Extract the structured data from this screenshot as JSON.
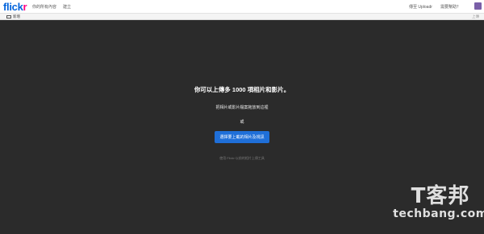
{
  "app": {
    "logo_main": "flick",
    "logo_accent": "r"
  },
  "topbar": {
    "nav_you": "你的所有內容",
    "nav_create": "建立",
    "upload": "傳至 Uploadr",
    "help": "需要幫助？",
    "avatar_icon": "user-avatar-icon"
  },
  "subbar": {
    "add_label": "新增",
    "right_label": "上傳"
  },
  "main": {
    "headline": "你可以上傳多 1000 項相片和影片。",
    "drag_hint": "把相片或影片檔案拖放到這裡",
    "or": "或",
    "choose_button": "選擇要上載的相片及視訊",
    "old_uploader": "使用 Flickr 以前的相片上傳工具"
  },
  "watermark": {
    "mark": "T客邦",
    "name": "techbang.com"
  },
  "colors": {
    "background": "#2b2b2b",
    "primary_button": "#1f6fd8",
    "logo_blue": "#0063dc",
    "logo_pink": "#ff0084"
  }
}
